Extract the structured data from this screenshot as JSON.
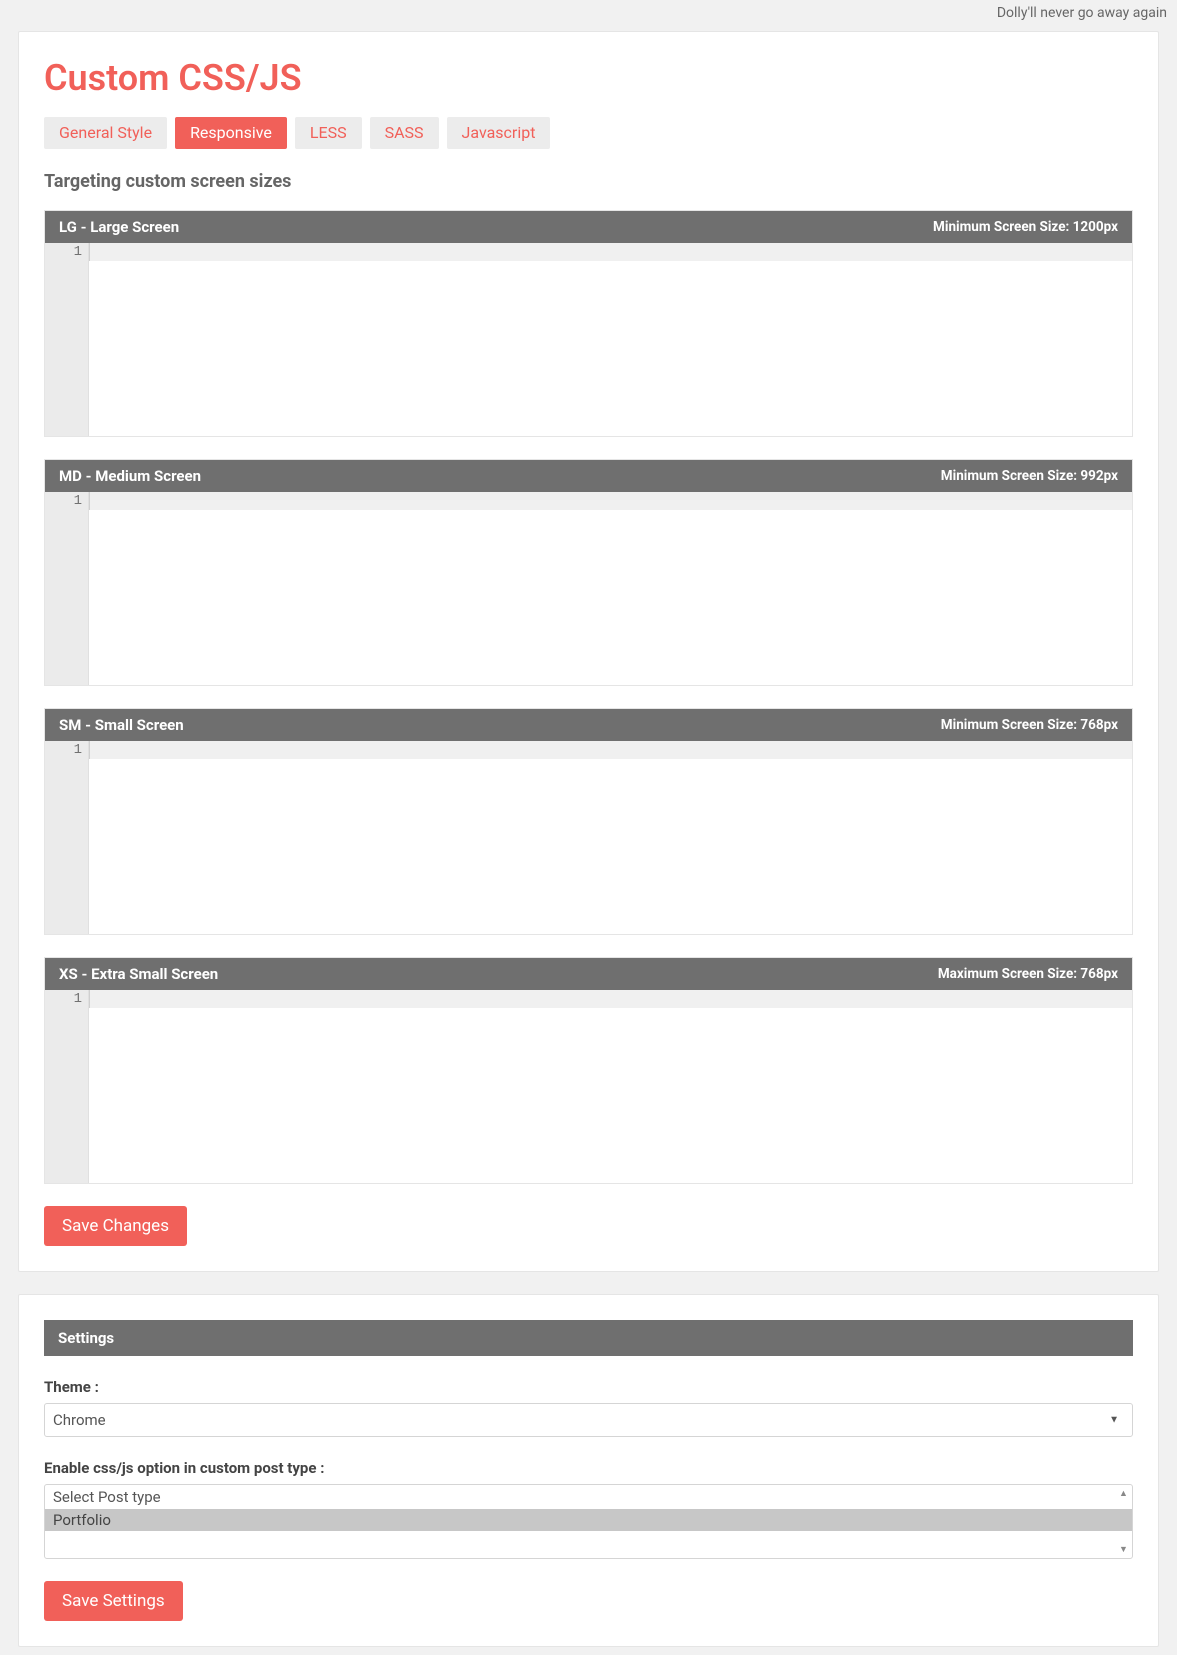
{
  "top_banner": "Dolly'll never go away again",
  "page_title": "Custom CSS/JS",
  "tabs": [
    {
      "label": "General Style",
      "active": false
    },
    {
      "label": "Responsive",
      "active": true
    },
    {
      "label": "LESS",
      "active": false
    },
    {
      "label": "SASS",
      "active": false
    },
    {
      "label": "Javascript",
      "active": false
    }
  ],
  "section_subtitle": "Targeting custom screen sizes",
  "editors": [
    {
      "title": "LG - Large Screen",
      "meta": "Minimum Screen Size: 1200px",
      "line": "1",
      "content": ""
    },
    {
      "title": "MD - Medium Screen",
      "meta": "Minimum Screen Size: 992px",
      "line": "1",
      "content": ""
    },
    {
      "title": "SM - Small Screen",
      "meta": "Minimum Screen Size: 768px",
      "line": "1",
      "content": ""
    },
    {
      "title": "XS - Extra Small Screen",
      "meta": "Maximum Screen Size: 768px",
      "line": "1",
      "content": ""
    }
  ],
  "save_changes_label": "Save Changes",
  "settings": {
    "header": "Settings",
    "theme_label": "Theme :",
    "theme_value": "Chrome",
    "post_type_label": "Enable css/js option in custom post type :",
    "post_type_placeholder": "Select Post type",
    "post_type_items": [
      "Portfolio"
    ],
    "save_label": "Save Settings"
  }
}
